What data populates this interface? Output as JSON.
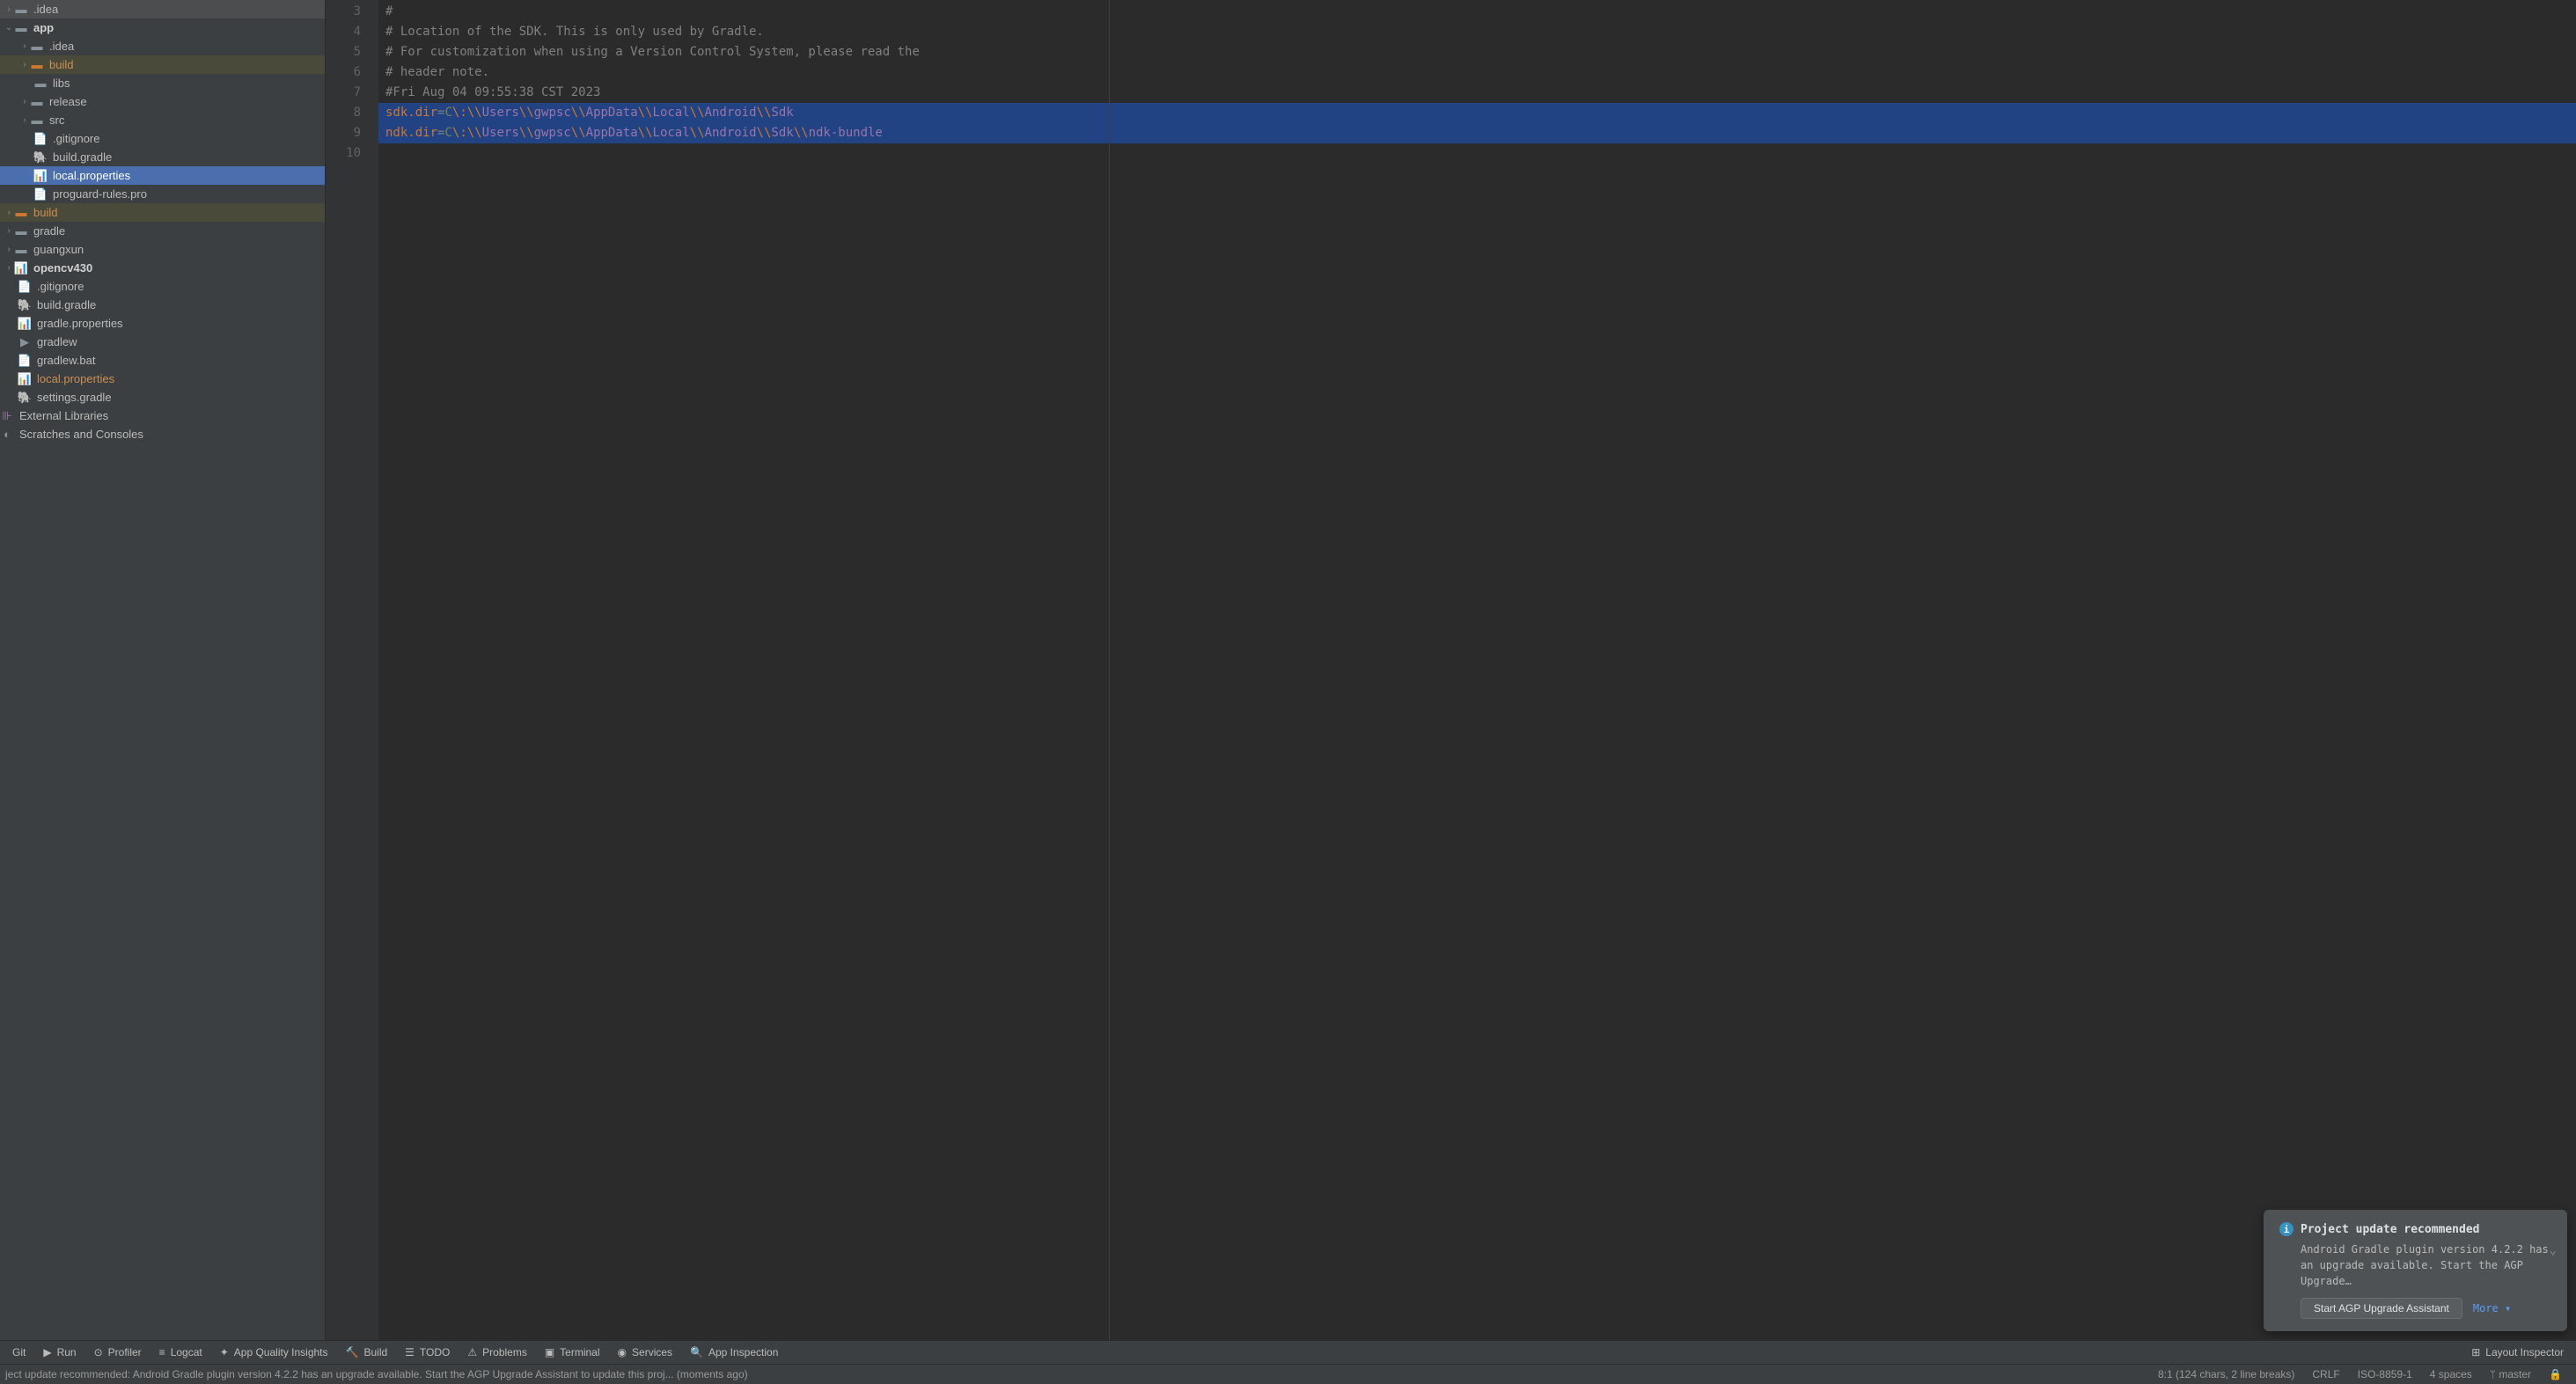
{
  "tree": {
    "idea_root": ".idea",
    "app": "app",
    "app_idea": ".idea",
    "app_build": "build",
    "app_libs": "libs",
    "app_release": "release",
    "app_src": "src",
    "app_gitignore": ".gitignore",
    "app_buildgradle": "build.gradle",
    "app_localprops": "local.properties",
    "app_proguard": "proguard-rules.pro",
    "build": "build",
    "gradle": "gradle",
    "guangxun": "guangxun",
    "opencv": "opencv430",
    "gitignore": ".gitignore",
    "buildgradle": "build.gradle",
    "gradleprops": "gradle.properties",
    "gradlew": "gradlew",
    "gradlewbat": "gradlew.bat",
    "localprops": "local.properties",
    "settings": "settings.gradle",
    "extlib": "External Libraries",
    "scratches": "Scratches and Consoles"
  },
  "editor": {
    "lines": [
      3,
      4,
      5,
      6,
      7,
      8,
      9,
      10
    ],
    "l3": "#",
    "l4": "# Location of the SDK. This is only used by Gradle.",
    "l5": "# For customization when using a Version Control System, please read the",
    "l6": "# header note.",
    "l7": "#Fri Aug 04 09:55:38 CST 2023",
    "l8_key": "sdk.dir",
    "l9_key": "ndk.dir",
    "eq": "=",
    "drive": "C",
    "colon_esc": "\\:",
    "sep": "\\\\",
    "users": "Users",
    "user": "gwpsc",
    "appdata": "AppData",
    "local": "Local",
    "android": "Android",
    "sdk": "Sdk",
    "ndk": "ndk-bundle"
  },
  "notification": {
    "title": "Project update recommended",
    "body": "Android Gradle plugin version 4.2.2 has an upgrade available. Start the AGP Upgrade…",
    "button": "Start AGP Upgrade Assistant",
    "more": "More"
  },
  "panel": {
    "git": "Git",
    "run": "Run",
    "profiler": "Profiler",
    "logcat": "Logcat",
    "insights": "App Quality Insights",
    "build": "Build",
    "todo": "TODO",
    "problems": "Problems",
    "terminal": "Terminal",
    "services": "Services",
    "inspection": "App Inspection",
    "layout": "Layout Inspector"
  },
  "status": {
    "message": "ject update recommended: Android Gradle plugin version 4.2.2 has an upgrade available.  Start the AGP Upgrade Assistant to update this proj... (moments ago)",
    "pos": "8:1 (124 chars, 2 line breaks)",
    "lineend": "CRLF",
    "encoding": "ISO-8859-1",
    "indent": "4 spaces",
    "branch": "master"
  }
}
